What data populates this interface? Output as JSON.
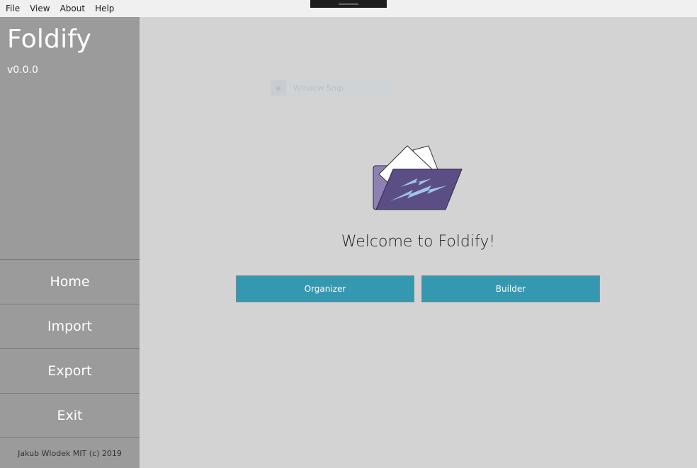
{
  "menubar": {
    "items": [
      "File",
      "View",
      "About",
      "Help"
    ]
  },
  "sidebar": {
    "title": "Foldify",
    "version": "v0.0.0",
    "nav": [
      "Home",
      "Import",
      "Export",
      "Exit"
    ],
    "footer": "Jakub Wlodek MIT (c) 2019"
  },
  "overlay": {
    "window_snip_label": "Window Snip"
  },
  "main": {
    "welcome": "Welcome to Foldify!",
    "buttons": {
      "organizer": "Organizer",
      "builder": "Builder"
    },
    "logo_icon": "folder-lightning-icon"
  },
  "colors": {
    "sidebar_bg": "#9b9b9b",
    "main_bg": "#d3d3d3",
    "button_bg": "#3598b1",
    "folder_purple": "#5b4e85",
    "bolt_blue": "#9fc5e8"
  }
}
